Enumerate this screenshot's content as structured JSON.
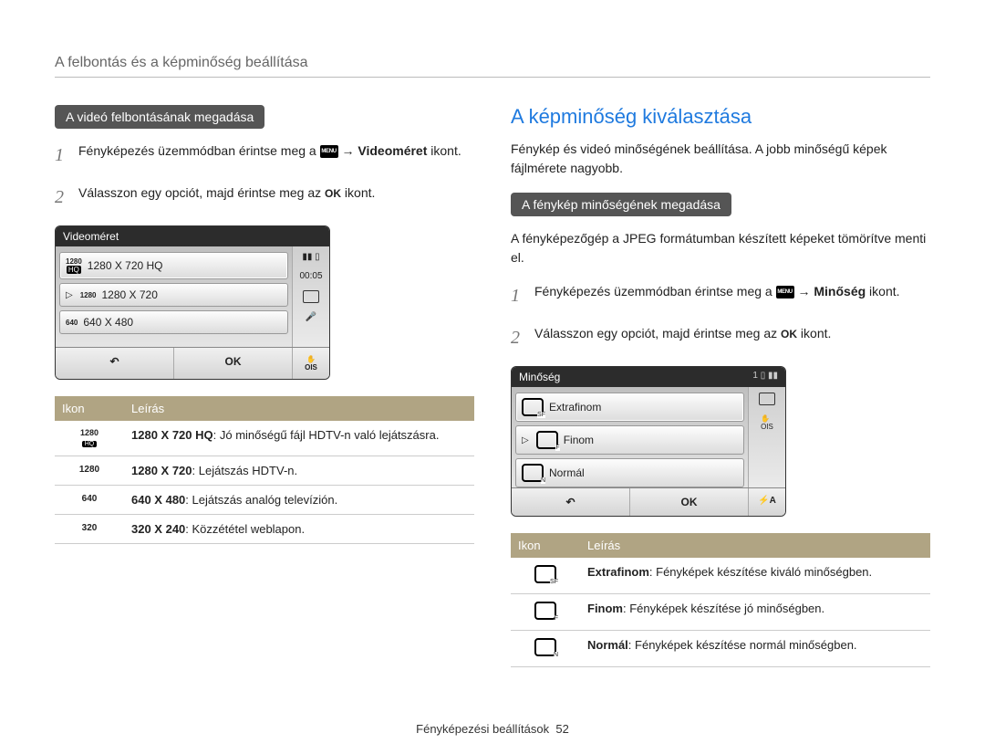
{
  "breadcrumb": "A felbontás és a képminőség beállítása",
  "left": {
    "pill": "A videó felbontásának megadása",
    "step1_a": "Fényképezés üzemmódban érintse meg a ",
    "menu_chip": "MENU",
    "step1_arrow": " → ",
    "step1_bold": "Videoméret",
    "step1_end": " ikont.",
    "step2_a": "Válasszon egy opciót, majd érintse meg az ",
    "ok_chip": "OK",
    "step2_end": " ikont.",
    "lcd": {
      "title": "Videoméret",
      "time": "00:05",
      "items": [
        {
          "badge_top": "1280",
          "badge_bot": "HQ",
          "label": "1280 X 720 HQ",
          "selected": true
        },
        {
          "badge_top": "1280",
          "badge_bot": "",
          "label": "1280 X 720",
          "selected": false,
          "pointer": true
        },
        {
          "badge_top": "640",
          "badge_bot": "",
          "label": "640 X 480",
          "selected": false
        }
      ],
      "ok": "OK",
      "back": "↶",
      "ois": "OIS"
    },
    "table": {
      "head_icon": "Ikon",
      "head_desc": "Leírás",
      "rows": [
        {
          "icon_top": "1280",
          "icon_bot": "HQ",
          "bold": "1280 X 720 HQ",
          "rest": ": Jó minőségű fájl HDTV-n való lejátszásra."
        },
        {
          "icon_top": "1280",
          "icon_bot": "",
          "bold": "1280 X 720",
          "rest": ": Lejátszás HDTV-n."
        },
        {
          "icon_top": "640",
          "icon_bot": "",
          "bold": "640 X 480",
          "rest": ": Lejátszás analóg televízión."
        },
        {
          "icon_top": "320",
          "icon_bot": "",
          "bold": "320 X 240",
          "rest": ": Közzététel weblapon."
        }
      ]
    }
  },
  "right": {
    "heading": "A képminőség kiválasztása",
    "intro": "Fénykép és videó minőségének beállítása. A jobb minőségű képek fájlmérete nagyobb.",
    "pill": "A fénykép minőségének megadása",
    "sub": "A fényképezőgép a JPEG formátumban készített képeket tömörítve menti el.",
    "step1_a": "Fényképezés üzemmódban érintse meg a ",
    "menu_chip": "MENU",
    "step1_arrow": " → ",
    "step1_bold": "Minőség",
    "step1_end": " ikont.",
    "step2_a": "Válasszon egy opciót, majd érintse meg az ",
    "ok_chip": "OK",
    "step2_end": " ikont.",
    "lcd": {
      "title": "Minőség",
      "count": "1",
      "items": [
        {
          "sub": "SF",
          "label": "Extrafinom",
          "selected": true
        },
        {
          "sub": "F",
          "label": "Finom",
          "pointer": true
        },
        {
          "sub": "N",
          "label": "Normál"
        }
      ],
      "ok": "OK",
      "back": "↶",
      "ois": "OIS",
      "flash": "⚡A"
    },
    "table": {
      "head_icon": "Ikon",
      "head_desc": "Leírás",
      "rows": [
        {
          "sub": "SF",
          "bold": "Extrafinom",
          "rest": ": Fényképek készítése kiváló minőségben."
        },
        {
          "sub": "F",
          "bold": "Finom",
          "rest": ": Fényképek készítése jó minőségben."
        },
        {
          "sub": "N",
          "bold": "Normál",
          "rest": ": Fényképek készítése normál minőségben."
        }
      ]
    }
  },
  "footer_label": "Fényképezési beállítások",
  "footer_page": "52"
}
